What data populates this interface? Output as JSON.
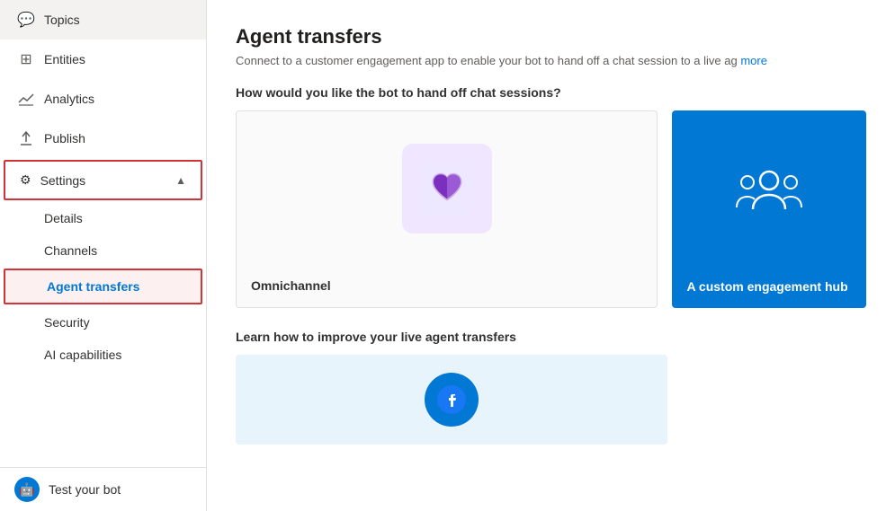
{
  "sidebar": {
    "items": [
      {
        "id": "topics",
        "label": "Topics",
        "icon": "💬"
      },
      {
        "id": "entities",
        "label": "Entities",
        "icon": "⊞"
      },
      {
        "id": "analytics",
        "label": "Analytics",
        "icon": "📈"
      },
      {
        "id": "publish",
        "label": "Publish",
        "icon": "⬆"
      }
    ],
    "settings": {
      "label": "Settings",
      "icon": "⚙",
      "subitems": [
        {
          "id": "details",
          "label": "Details"
        },
        {
          "id": "channels",
          "label": "Channels"
        },
        {
          "id": "agent-transfers",
          "label": "Agent transfers",
          "active": true
        },
        {
          "id": "security",
          "label": "Security"
        },
        {
          "id": "ai-capabilities",
          "label": "AI capabilities"
        }
      ]
    },
    "bottom": {
      "label": "Test your bot",
      "avatar_icon": "🤖"
    }
  },
  "main": {
    "title": "Agent transfers",
    "subtitle": "Connect to a customer engagement app to enable your bot to hand off a chat session to a live ag",
    "learn_more_link": "more",
    "hand_off_label": "How would you like the bot to hand off chat sessions?",
    "cards": [
      {
        "id": "omnichannel",
        "label": "Omnichannel"
      },
      {
        "id": "custom-hub",
        "label": "A custom engagement hub"
      }
    ],
    "learn_section_label": "Learn how to improve your live agent transfers"
  }
}
